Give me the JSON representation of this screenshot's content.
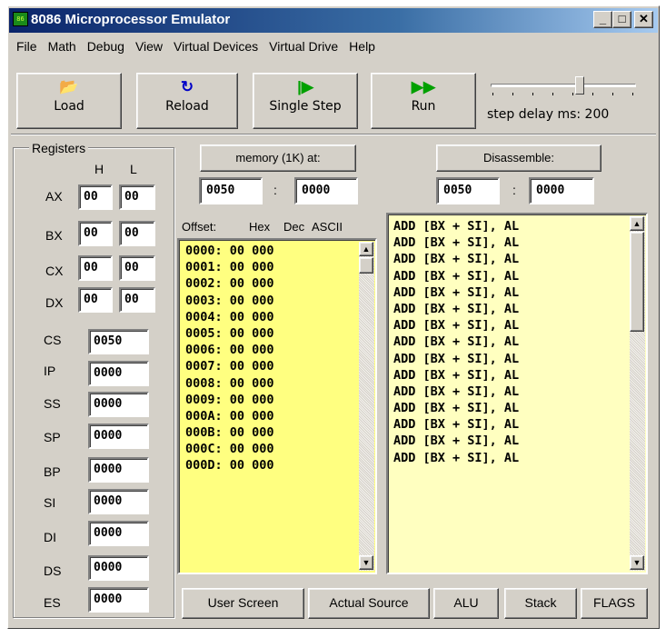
{
  "window": {
    "title": "8086 Microprocessor Emulator",
    "icon": "chip-icon"
  },
  "caption_buttons": {
    "minimize": "_",
    "maximize": "□",
    "close": "✕"
  },
  "menu": [
    "File",
    "Math",
    "Debug",
    "View",
    "Virtual Devices",
    "Virtual Drive",
    "Help"
  ],
  "toolbar": {
    "load": "Load",
    "reload": "Reload",
    "single_step": "Single Step",
    "run": "Run",
    "step_delay_label": "step delay ms: 200",
    "step_delay_ms": 200
  },
  "registers": {
    "group_label": "Registers",
    "h_label": "H",
    "l_label": "L",
    "split": [
      {
        "name": "AX",
        "h": "00",
        "l": "00"
      },
      {
        "name": "BX",
        "h": "00",
        "l": "00"
      },
      {
        "name": "CX",
        "h": "00",
        "l": "00"
      },
      {
        "name": "DX",
        "h": "00",
        "l": "00"
      }
    ],
    "full": [
      {
        "name": "CS",
        "value": "0050"
      },
      {
        "name": "IP",
        "value": "0000"
      },
      {
        "name": "SS",
        "value": "0000"
      },
      {
        "name": "SP",
        "value": "0000"
      },
      {
        "name": "BP",
        "value": "0000"
      },
      {
        "name": "SI",
        "value": "0000"
      },
      {
        "name": "DI",
        "value": "0000"
      },
      {
        "name": "DS",
        "value": "0000"
      },
      {
        "name": "ES",
        "value": "0000"
      }
    ]
  },
  "memory": {
    "button": "memory (1K) at:",
    "segment": "0050",
    "separator": ":",
    "offset": "0000",
    "headers": {
      "offset": "Offset:",
      "hex": "Hex",
      "dec": "Dec",
      "ascii": "ASCII"
    },
    "rows": [
      "0000: 00 000",
      "0001: 00 000",
      "0002: 00 000",
      "0003: 00 000",
      "0004: 00 000",
      "0005: 00 000",
      "0006: 00 000",
      "0007: 00 000",
      "0008: 00 000",
      "0009: 00 000",
      "000A: 00 000",
      "000B: 00 000",
      "000C: 00 000",
      "000D: 00 000"
    ]
  },
  "disassemble": {
    "button": "Disassemble:",
    "segment": "0050",
    "separator": ":",
    "offset": "0000",
    "rows": [
      "ADD [BX + SI], AL",
      "ADD [BX + SI], AL",
      "ADD [BX + SI], AL",
      "ADD [BX + SI], AL",
      "ADD [BX + SI], AL",
      "ADD [BX + SI], AL",
      "ADD [BX + SI], AL",
      "ADD [BX + SI], AL",
      "ADD [BX + SI], AL",
      "ADD [BX + SI], AL",
      "ADD [BX + SI], AL",
      "ADD [BX + SI], AL",
      "ADD [BX + SI], AL",
      "ADD [BX + SI], AL",
      "ADD [BX + SI], AL"
    ]
  },
  "bottom_buttons": [
    "User Screen",
    "Actual Source",
    "ALU",
    "Stack",
    "FLAGS"
  ],
  "colors": {
    "memory_bg": "#ffff80",
    "disasm_bg": "#ffffc0",
    "title_start": "#0a246a",
    "title_end": "#a6caf0"
  }
}
